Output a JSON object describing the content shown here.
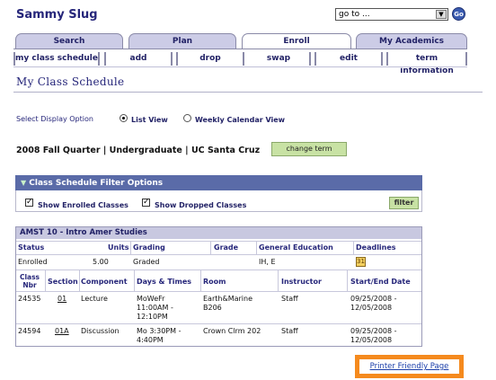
{
  "header": {
    "app_name": "Sammy Slug",
    "goto_value": "go to ...",
    "go_label": "Go"
  },
  "tabs": [
    {
      "label": "Search"
    },
    {
      "label": "Plan"
    },
    {
      "label": "Enroll"
    },
    {
      "label": "My Academics"
    }
  ],
  "subtabs": [
    {
      "label": "my class schedule"
    },
    {
      "label": "add"
    },
    {
      "label": "drop"
    },
    {
      "label": "swap"
    },
    {
      "label": "edit"
    },
    {
      "label": "term information"
    }
  ],
  "page_title": "My Class Schedule",
  "display_option": {
    "label": "Select Display Option",
    "options": [
      "List View",
      "Weekly Calendar View"
    ],
    "selected": "List View"
  },
  "term": {
    "text": "2008 Fall Quarter | Undergraduate | UC Santa Cruz",
    "change_label": "change term"
  },
  "filter": {
    "header": "Class Schedule Filter Options",
    "show_enrolled": "Show Enrolled Classes",
    "show_dropped": "Show Dropped Classes",
    "button": "filter"
  },
  "class": {
    "title": "AMST 10 - Intro Amer Studies",
    "summary_headers": [
      "Status",
      "Units",
      "Grading",
      "Grade",
      "General Education",
      "Deadlines"
    ],
    "summary": {
      "status": "Enrolled",
      "units": "5.00",
      "grading": "Graded",
      "grade": "",
      "ge": "IH, E"
    },
    "section_headers": {
      "class_nbr_1": "Class",
      "class_nbr_2": "Nbr",
      "section": "Section",
      "component": "Component",
      "days_times": "Days & Times",
      "room": "Room",
      "instructor": "Instructor",
      "dates": "Start/End Date"
    },
    "rows": [
      {
        "nbr": "24535",
        "section": "01",
        "component": "Lecture",
        "days1": "MoWeFr",
        "days2": "11:00AM -",
        "days3": "12:10PM",
        "room1": "Earth&Marine",
        "room2": "B206",
        "instructor": "Staff",
        "date1": "09/25/2008 -",
        "date2": "12/05/2008"
      },
      {
        "nbr": "24594",
        "section": "01A",
        "component": "Discussion",
        "days1": "Mo 3:30PM -",
        "days2": "4:40PM",
        "room1": "Crown Clrm 202",
        "instructor": "Staff",
        "date1": "09/25/2008 -",
        "date2": "12/05/2008"
      }
    ]
  },
  "printer_link": "Printer Friendly Page",
  "colors": {
    "brand_navy": "#26267a",
    "tab_bg": "#cccce6",
    "filter_header": "#5a6ba8",
    "button_green": "#c8e2a4",
    "highlight_orange": "#f58a1e"
  }
}
